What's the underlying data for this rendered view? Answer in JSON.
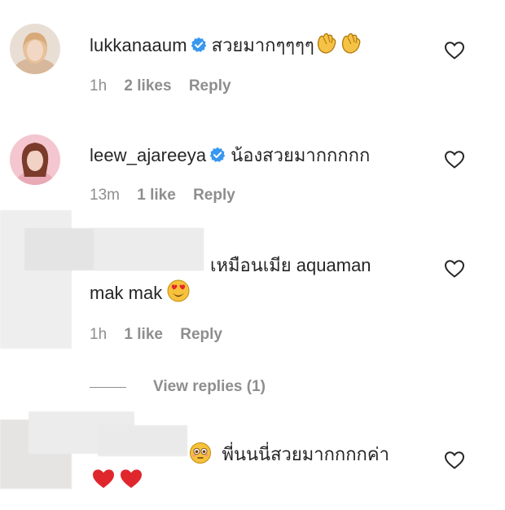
{
  "comments": [
    {
      "username": "lukkanaaum",
      "verified": true,
      "text": "สวยมากๆๆๆๆ",
      "emoji": [
        "clapping-hands",
        "clapping-hands"
      ],
      "time": "1h",
      "likes": "2 likes",
      "reply": "Reply"
    },
    {
      "username": "leew_ajareeya",
      "verified": true,
      "text": "น้องสวยมากกกกก",
      "time": "13m",
      "likes": "1 like",
      "reply": "Reply"
    },
    {
      "username": "",
      "verified": false,
      "text_line1": "เหมือนเมีย aquaman",
      "text_line2": "mak mak",
      "emoji": [
        "heart-eyes-face"
      ],
      "time": "1h",
      "likes": "1 like",
      "reply": "Reply",
      "view_replies": "View replies (1)"
    },
    {
      "username": "",
      "verified": false,
      "text": "พี่นนนี่สวยมากกกกค่า",
      "emoji": [
        "flushed-face",
        "red-heart",
        "red-heart"
      ]
    }
  ],
  "colors": {
    "text": "#262626",
    "muted": "#8e8e8e",
    "verified_blue": "#3897f0",
    "heart_red": "#e0262d"
  }
}
